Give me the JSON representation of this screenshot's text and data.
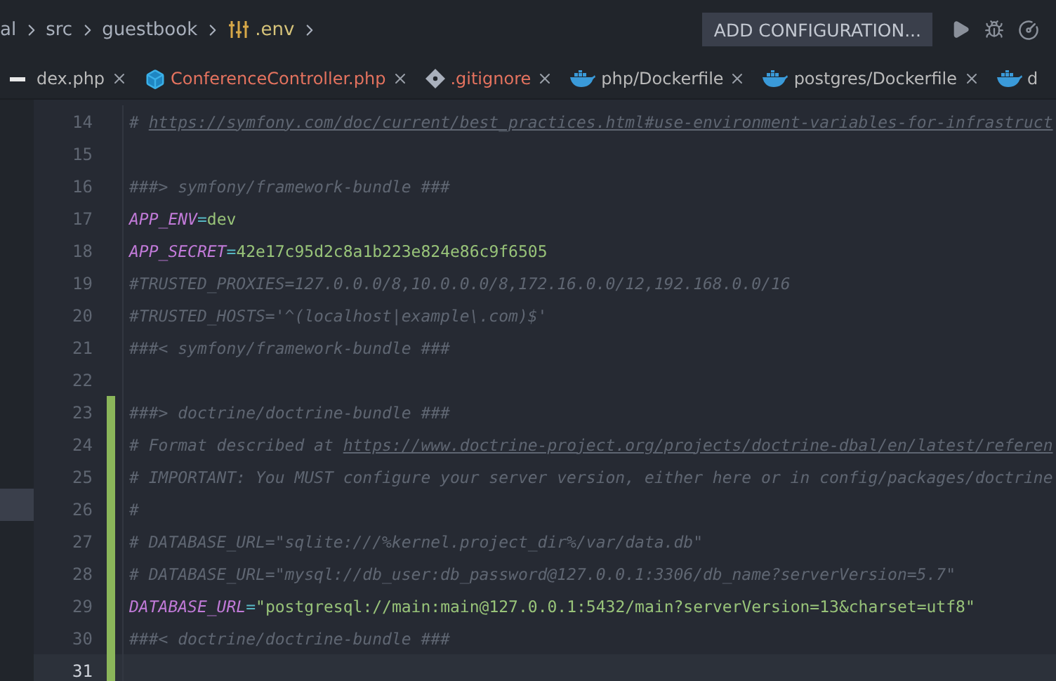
{
  "breadcrumbs": [
    {
      "label": "al",
      "kind": "folder"
    },
    {
      "label": "src",
      "kind": "folder"
    },
    {
      "label": "guestbook",
      "kind": "folder"
    },
    {
      "label": ".env",
      "kind": "env"
    }
  ],
  "toolbar": {
    "button": "ADD CONFIGURATION..."
  },
  "tabs": [
    {
      "label": "dex.php",
      "kind": "plain",
      "color": "#bbbbbb"
    },
    {
      "label": "ConferenceController.php",
      "kind": "class",
      "color": "#e5735f"
    },
    {
      "label": ".gitignore",
      "kind": "git",
      "color": "#e5735f"
    },
    {
      "label": "php/Dockerfile",
      "kind": "docker",
      "color": "#bbbbbb"
    },
    {
      "label": "postgres/Dockerfile",
      "kind": "docker",
      "color": "#bbbbbb"
    },
    {
      "label": "d",
      "kind": "docker",
      "color": "#bbbbbb"
    }
  ],
  "editor": {
    "lines": [
      {
        "number": "14",
        "changed": false,
        "current": false,
        "tokens": [
          {
            "kind": "comment",
            "text": "# "
          },
          {
            "kind": "link",
            "text": "https://symfony.com/doc/current/best_practices.html#use-environment-variables-for-infrastruct"
          }
        ]
      },
      {
        "number": "15",
        "changed": false,
        "current": false
      },
      {
        "number": "16",
        "changed": false,
        "current": false,
        "tokens": [
          {
            "kind": "comment",
            "text": "###> symfony/framework-bundle ###"
          }
        ]
      },
      {
        "number": "17",
        "changed": false,
        "current": false,
        "tokens": [
          {
            "kind": "key",
            "text": "APP_ENV"
          },
          {
            "kind": "eq",
            "text": "="
          },
          {
            "kind": "value",
            "text": "dev"
          }
        ]
      },
      {
        "number": "18",
        "changed": false,
        "current": false,
        "tokens": [
          {
            "kind": "key",
            "text": "APP_SECRET"
          },
          {
            "kind": "eq",
            "text": "="
          },
          {
            "kind": "value",
            "text": "42e17c95d2c8a1b223e824e86c9f6505"
          }
        ]
      },
      {
        "number": "19",
        "changed": false,
        "current": false,
        "tokens": [
          {
            "kind": "comment",
            "text": "#TRUSTED_PROXIES=127.0.0.0/8,10.0.0.0/8,172.16.0.0/12,192.168.0.0/16"
          }
        ]
      },
      {
        "number": "20",
        "changed": false,
        "current": false,
        "tokens": [
          {
            "kind": "comment",
            "text": "#TRUSTED_HOSTS='^(localhost|example\\.com)$'"
          }
        ]
      },
      {
        "number": "21",
        "changed": false,
        "current": false,
        "tokens": [
          {
            "kind": "comment",
            "text": "###< symfony/framework-bundle ###"
          }
        ]
      },
      {
        "number": "22",
        "changed": false,
        "current": false
      },
      {
        "number": "23",
        "changed": true,
        "current": false,
        "tokens": [
          {
            "kind": "comment",
            "text": "###> doctrine/doctrine-bundle ###"
          }
        ]
      },
      {
        "number": "24",
        "changed": true,
        "current": false,
        "tokens": [
          {
            "kind": "comment",
            "text": "# Format described at "
          },
          {
            "kind": "link",
            "text": "https://www.doctrine-project.org/projects/doctrine-dbal/en/latest/referen"
          }
        ]
      },
      {
        "number": "25",
        "changed": true,
        "current": false,
        "tokens": [
          {
            "kind": "comment",
            "text": "# IMPORTANT: You MUST configure your server version, either here or in config/packages/doctrine"
          }
        ]
      },
      {
        "number": "26",
        "changed": true,
        "current": false,
        "tokens": [
          {
            "kind": "comment",
            "text": "#"
          }
        ]
      },
      {
        "number": "27",
        "changed": true,
        "current": false,
        "tokens": [
          {
            "kind": "comment",
            "text": "# DATABASE_URL=\"sqlite:///%kernel.project_dir%/var/data.db\""
          }
        ]
      },
      {
        "number": "28",
        "changed": true,
        "current": false,
        "tokens": [
          {
            "kind": "comment",
            "text": "# DATABASE_URL=\"mysql://db_user:db_password@127.0.0.1:3306/db_name?serverVersion=5.7\""
          }
        ]
      },
      {
        "number": "29",
        "changed": true,
        "current": false,
        "tokens": [
          {
            "kind": "key",
            "text": "DATABASE_URL"
          },
          {
            "kind": "eq",
            "text": "="
          },
          {
            "kind": "value",
            "text": "\"postgresql://main:main@127.0.0.1:5432/main?serverVersion=13&charset=utf8\""
          }
        ]
      },
      {
        "number": "30",
        "changed": true,
        "current": false,
        "tokens": [
          {
            "kind": "comment",
            "text": "###< doctrine/doctrine-bundle ###"
          }
        ]
      },
      {
        "number": "31",
        "changed": true,
        "current": true
      }
    ]
  }
}
